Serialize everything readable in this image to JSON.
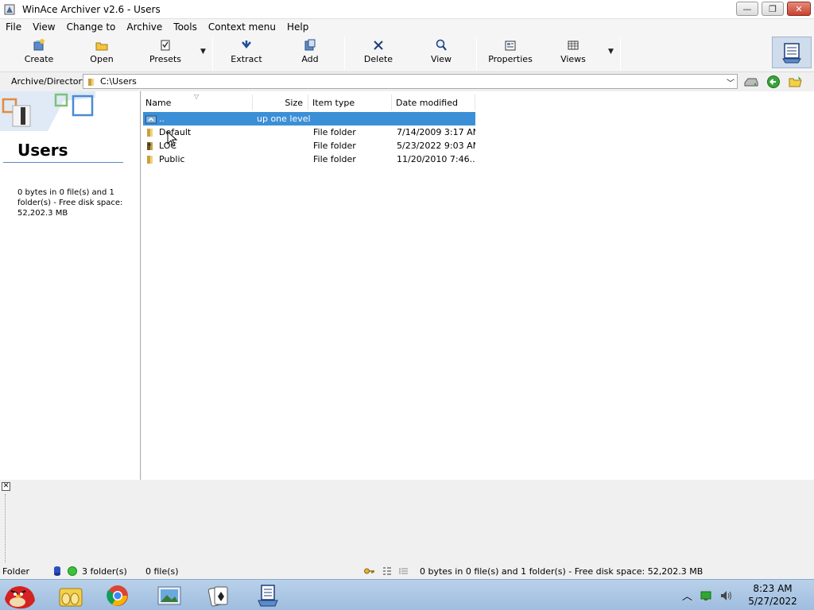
{
  "window": {
    "title": "WinAce Archiver v2.6 - Users",
    "minimize_glyph": "—",
    "restore_glyph": "❐",
    "close_glyph": "✕"
  },
  "menu": [
    "File",
    "View",
    "Change to",
    "Archive",
    "Tools",
    "Context menu",
    "Help"
  ],
  "toolbar": {
    "create": "Create",
    "open": "Open",
    "presets": "Presets",
    "extract": "Extract",
    "add": "Add",
    "delete": "Delete",
    "view": "View",
    "properties": "Properties",
    "views": "Views"
  },
  "address": {
    "label": "Archive/Directory",
    "path": "C:\\Users"
  },
  "left_panel": {
    "title": "Users",
    "info": "0 bytes in 0 file(s) and 1 folder(s) - Free disk space: 52,202.3 MB"
  },
  "columns": {
    "name": "Name",
    "size": "Size",
    "type": "Item type",
    "date": "Date modified"
  },
  "rows": [
    {
      "name": "..",
      "size": "",
      "type": "",
      "date": "",
      "note": "up one level"
    },
    {
      "name": "Default",
      "size": "",
      "type": "File folder",
      "date": "7/14/2009 3:17 AM"
    },
    {
      "name": "LOC",
      "size": "",
      "type": "File folder",
      "date": "5/23/2022 9:03 AM"
    },
    {
      "name": "Public",
      "size": "",
      "type": "File folder",
      "date": "11/20/2010 7:46..."
    }
  ],
  "status": {
    "kind": "Folder",
    "folders": "3 folder(s)",
    "files": "0 file(s)",
    "summary": "0 bytes in 0 file(s) and 1 folder(s) - Free disk space: 52,202.3 MB"
  },
  "clock": {
    "time": "8:23 AM",
    "date": "5/27/2022"
  },
  "colors": {
    "selection": "#3b8fd6",
    "taskbar": "#b9d1ea"
  }
}
